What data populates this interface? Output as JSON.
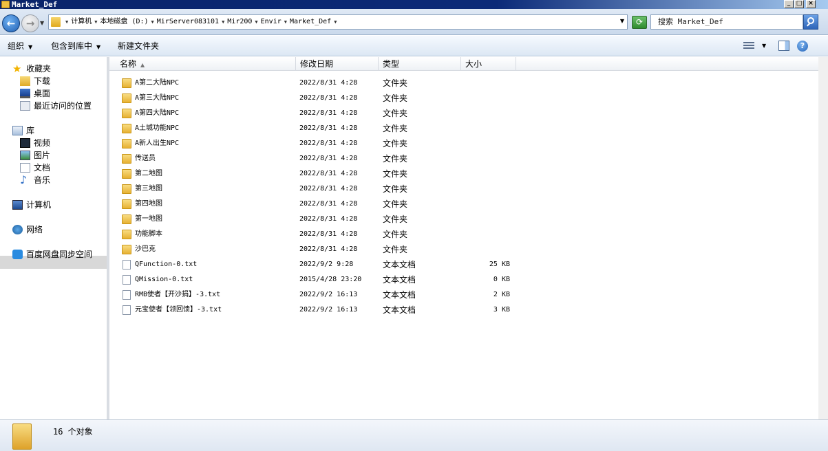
{
  "window": {
    "title": "Market_Def"
  },
  "address": {
    "crumbs": [
      "计算机",
      "本地磁盘 (D:)",
      "MirServer083101",
      "Mir200",
      "Envir",
      "Market_Def"
    ],
    "search_placeholder": "搜索 Market_Def"
  },
  "toolbar": {
    "organize": "组织",
    "include": "包含到库中",
    "new_folder": "新建文件夹"
  },
  "nav": {
    "favorites": "收藏夹",
    "downloads": "下载",
    "desktop": "桌面",
    "recent": "最近访问的位置",
    "libraries": "库",
    "videos": "视频",
    "pictures": "图片",
    "documents": "文档",
    "music": "音乐",
    "computer": "计算机",
    "network": "网络",
    "baidu": "百度网盘同步空间"
  },
  "columns": {
    "name": "名称",
    "date": "修改日期",
    "type": "类型",
    "size": "大小"
  },
  "files": [
    {
      "name": "A第二大陆NPC",
      "date": "2022/8/31 4:28",
      "type": "文件夹",
      "size": "",
      "kind": "folder"
    },
    {
      "name": "A第三大陆NPC",
      "date": "2022/8/31 4:28",
      "type": "文件夹",
      "size": "",
      "kind": "folder"
    },
    {
      "name": "A第四大陆NPC",
      "date": "2022/8/31 4:28",
      "type": "文件夹",
      "size": "",
      "kind": "folder"
    },
    {
      "name": "A土城功能NPC",
      "date": "2022/8/31 4:28",
      "type": "文件夹",
      "size": "",
      "kind": "folder"
    },
    {
      "name": "A新人出生NPC",
      "date": "2022/8/31 4:28",
      "type": "文件夹",
      "size": "",
      "kind": "folder"
    },
    {
      "name": "传送员",
      "date": "2022/8/31 4:28",
      "type": "文件夹",
      "size": "",
      "kind": "folder"
    },
    {
      "name": "第二地图",
      "date": "2022/8/31 4:28",
      "type": "文件夹",
      "size": "",
      "kind": "folder"
    },
    {
      "name": "第三地图",
      "date": "2022/8/31 4:28",
      "type": "文件夹",
      "size": "",
      "kind": "folder"
    },
    {
      "name": "第四地图",
      "date": "2022/8/31 4:28",
      "type": "文件夹",
      "size": "",
      "kind": "folder"
    },
    {
      "name": "第一地图",
      "date": "2022/8/31 4:28",
      "type": "文件夹",
      "size": "",
      "kind": "folder"
    },
    {
      "name": "功能脚本",
      "date": "2022/8/31 4:28",
      "type": "文件夹",
      "size": "",
      "kind": "folder"
    },
    {
      "name": "沙巴克",
      "date": "2022/8/31 4:28",
      "type": "文件夹",
      "size": "",
      "kind": "folder"
    },
    {
      "name": "QFunction-0.txt",
      "date": "2022/9/2 9:28",
      "type": "文本文档",
      "size": "25 KB",
      "kind": "txt"
    },
    {
      "name": "QMission-0.txt",
      "date": "2015/4/28 23:20",
      "type": "文本文档",
      "size": "0 KB",
      "kind": "txt"
    },
    {
      "name": "RMB使者【开沙捐】-3.txt",
      "date": "2022/9/2 16:13",
      "type": "文本文档",
      "size": "2 KB",
      "kind": "txt"
    },
    {
      "name": "元宝使者【领回馈】-3.txt",
      "date": "2022/9/2 16:13",
      "type": "文本文档",
      "size": "3 KB",
      "kind": "txt"
    }
  ],
  "status": {
    "count_text": "16 个对象"
  }
}
